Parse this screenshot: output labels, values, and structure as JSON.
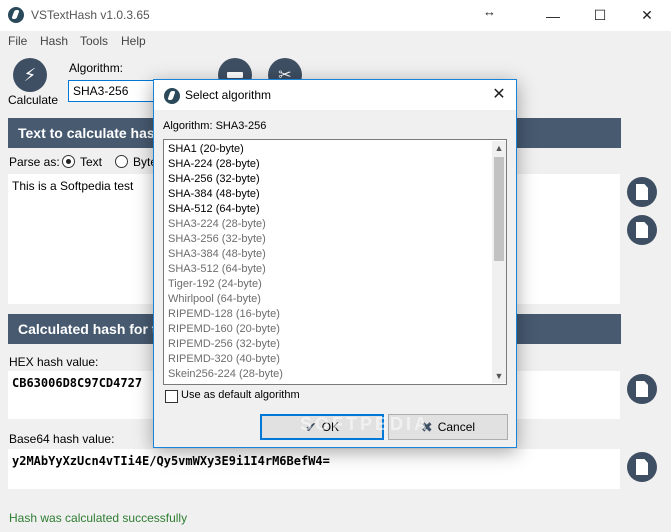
{
  "app": {
    "title": "VSTextHash v1.0.3.65"
  },
  "menu": [
    "File",
    "Hash",
    "Tools",
    "Help"
  ],
  "toolbar": {
    "calculate_label": "Calculate",
    "algorithm_label": "Algorithm:",
    "algorithm_value": "SHA3-256"
  },
  "text_section": {
    "header": "Text to calculate hash",
    "parse_label": "Parse as:",
    "option_text": "Text",
    "option_bytes": "Byte",
    "selected": "Text",
    "input": "This is a Softpedia test"
  },
  "hash_section": {
    "header": "Calculated hash for th",
    "hex_label": "HEX hash value:",
    "hex_value": "CB63006D8C97CD4727",
    "b64_label": "Base64 hash value:",
    "b64_value": "y2MAbYyXzUcn4vTIi4E/Qy5vmWXy3E9i1I4rM6BefW4="
  },
  "status": "Hash was calculated successfully",
  "dialog": {
    "title": "Select algorithm",
    "algorithm_line": "Algorithm: SHA3-256",
    "algorithms": [
      {
        "name": "SHA1 (20-byte)",
        "enabled": true
      },
      {
        "name": "SHA-224 (28-byte)",
        "enabled": true
      },
      {
        "name": "SHA-256 (32-byte)",
        "enabled": true
      },
      {
        "name": "SHA-384 (48-byte)",
        "enabled": true
      },
      {
        "name": "SHA-512 (64-byte)",
        "enabled": true
      },
      {
        "name": "SHA3-224 (28-byte)",
        "enabled": false
      },
      {
        "name": "SHA3-256 (32-byte)",
        "enabled": false
      },
      {
        "name": "SHA3-384 (48-byte)",
        "enabled": false
      },
      {
        "name": "SHA3-512 (64-byte)",
        "enabled": false
      },
      {
        "name": "Tiger-192 (24-byte)",
        "enabled": false
      },
      {
        "name": "Whirlpool (64-byte)",
        "enabled": false
      },
      {
        "name": "RIPEMD-128 (16-byte)",
        "enabled": false
      },
      {
        "name": "RIPEMD-160 (20-byte)",
        "enabled": false
      },
      {
        "name": "RIPEMD-256 (32-byte)",
        "enabled": false
      },
      {
        "name": "RIPEMD-320 (40-byte)",
        "enabled": false
      },
      {
        "name": "Skein256-224 (28-byte)",
        "enabled": false
      }
    ],
    "default_checkbox_label": "Use as default algorithm",
    "default_checked": false,
    "ok_label": "OK",
    "cancel_label": "Cancel"
  },
  "watermark": "SOFTPEDIA"
}
